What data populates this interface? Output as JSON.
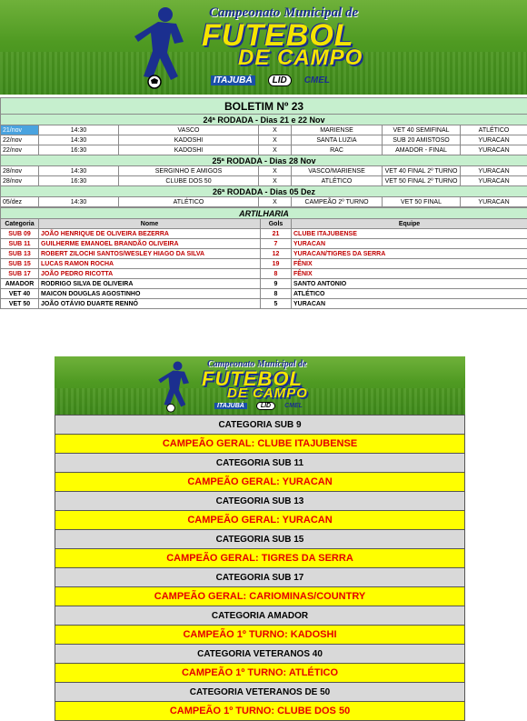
{
  "banner": {
    "title_top": "Campeonato Municipal de",
    "title_main_1": "FUTEBOL",
    "title_main_2": "DE CAMPO",
    "logos": [
      "ITAJUBÁ",
      "LID",
      "CMEL"
    ]
  },
  "bulletin": {
    "title": "BOLETIM Nº 23",
    "rounds": [
      {
        "heading": "24ª RODADA -  Dias 21 e 22 Nov",
        "games": [
          {
            "date": "21/nov",
            "time": "14:30",
            "home": "VASCO",
            "x": "X",
            "away": "MARIENSE",
            "category": "VET 40 SEMIFINAL",
            "venue": "ATLÉTICO",
            "highlight": true
          },
          {
            "date": "22/nov",
            "time": "14:30",
            "home": "KADOSHI",
            "x": "X",
            "away": "SANTA LUZIA",
            "category": "SUB 20 AMISTOSO",
            "venue": "YURACAN"
          },
          {
            "date": "22/nov",
            "time": "16:30",
            "home": "KADOSHI",
            "x": "X",
            "away": "RAC",
            "category": "AMADOR - FINAL",
            "venue": "YURACAN"
          }
        ]
      },
      {
        "heading": "25ª RODADA -  Dias 28 Nov",
        "games": [
          {
            "date": "28/nov",
            "time": "14:30",
            "home": "SERGINHO E AMIGOS",
            "x": "X",
            "away": "VASCO/MARIENSE",
            "category": "VET 40 FINAL 2º TURNO",
            "venue": "YURACAN"
          },
          {
            "date": "28/nov",
            "time": "16:30",
            "home": "CLUBE DOS 50",
            "x": "X",
            "away": "ATLÉTICO",
            "category": "VET 50 FINAL 2º TURNO",
            "venue": "YURACAN"
          }
        ]
      },
      {
        "heading": "26ª RODADA -  Dias 05 Dez",
        "games": [
          {
            "date": "05/dez",
            "time": "14:30",
            "home": "ATLÉTICO",
            "x": "X",
            "away": "CAMPEÃO 2º TURNO",
            "category": "VET 50 FINAL",
            "venue": "YURACAN"
          }
        ]
      }
    ],
    "scorers_heading": "ARTILHARIA",
    "scorers_columns": [
      "Categoria",
      "Nome",
      "Gols",
      "Equipe"
    ],
    "scorers": [
      {
        "category": "SUB 09",
        "name": "JOÃO HENRIQUE DE OLIVEIRA BEZERRA",
        "goals": "21",
        "team": "CLUBE ITAJUBENSE",
        "color": "red"
      },
      {
        "category": "SUB 11",
        "name": "GUILHERME EMANOEL BRANDÃO OLIVEIRA",
        "goals": "7",
        "team": "YURACAN",
        "color": "red"
      },
      {
        "category": "SUB 13",
        "name": "ROBERT ZILOCHI SANTOS/WESLEY HIAGO DA SILVA",
        "goals": "12",
        "team": "YURACAN/TIGRES DA SERRA",
        "color": "red"
      },
      {
        "category": "SUB 15",
        "name": "LUCAS RAMON ROCHA",
        "goals": "19",
        "team": "FÊNIX",
        "color": "red"
      },
      {
        "category": "SUB 17",
        "name": "JOÃO PEDRO RICOTTA",
        "goals": "8",
        "team": "FÊNIX",
        "color": "red"
      },
      {
        "category": "AMADOR",
        "name": "RODRIGO SILVA DE OLIVEIRA",
        "goals": "9",
        "team": "SANTO ANTONIO",
        "color": "black"
      },
      {
        "category": "VET  40",
        "name": "MAICON DOUGLAS AGOSTINHO",
        "goals": "8",
        "team": "ATLÉTICO",
        "color": "black"
      },
      {
        "category": "VET 50",
        "name": "JOÃO OTÁVIO DUARTE RENNÓ",
        "goals": "5",
        "team": "YURACAN",
        "color": "black"
      }
    ]
  },
  "champions": [
    {
      "category": "CATEGORIA  SUB  9",
      "winner": "CAMPEÃO GERAL: CLUBE ITAJUBENSE"
    },
    {
      "category": "CATEGORIA  SUB  11",
      "winner": "CAMPEÃO GERAL: YURACAN"
    },
    {
      "category": "CATEGORIA  SUB  13",
      "winner": "CAMPEÃO GERAL: YURACAN"
    },
    {
      "category": "CATEGORIA  SUB  15",
      "winner": "CAMPEÃO GERAL: TIGRES DA SERRA"
    },
    {
      "category": "CATEGORIA  SUB  17",
      "winner": "CAMPEÃO GERAL: CARIOMINAS/COUNTRY"
    },
    {
      "category": "CATEGORIA  AMADOR",
      "winner": "CAMPEÃO 1º TURNO:  KADOSHI"
    },
    {
      "category": "CATEGORIA VETERANOS 40",
      "winner": "CAMPEÃO 1º TURNO: ATLÉTICO"
    },
    {
      "category": "CATEGORIA  VETERANOS DE 50",
      "winner": "CAMPEÃO 1º TURNO: CLUBE DOS 50"
    }
  ]
}
